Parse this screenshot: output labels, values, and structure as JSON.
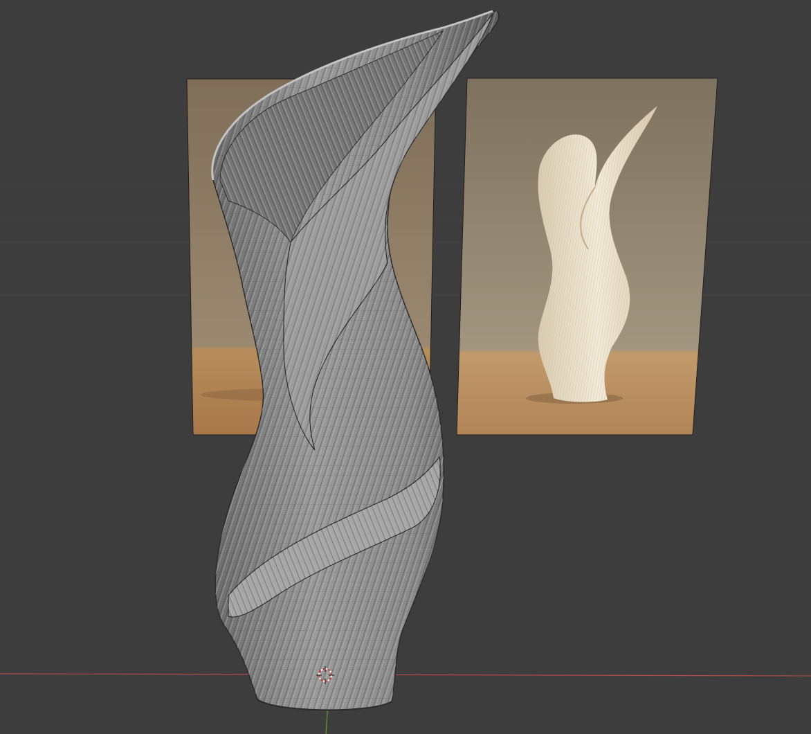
{
  "viewport": {
    "mode": "3d-viewport-solid-wireframe",
    "background_color": "#3d3d3d",
    "grid_line_color": "#474747",
    "x_axis_color": "#b34a4a",
    "y_axis_color": "#6aa033"
  },
  "scene": {
    "reference_images": [
      {
        "name": "reference-photo-left",
        "backdrop_color": "#8c7a62",
        "table_color": "#b08a5c",
        "object": "none"
      },
      {
        "name": "reference-photo-right",
        "backdrop_color": "#8a7c66",
        "table_color": "#b79266",
        "object_color": "#efe6d2"
      }
    ],
    "mesh": {
      "name": "twisted-vase-mesh",
      "shading_color": "#8e8e8e",
      "wire_color": "#2e2e2e"
    },
    "cursor_icon": "3d-cursor-icon"
  }
}
